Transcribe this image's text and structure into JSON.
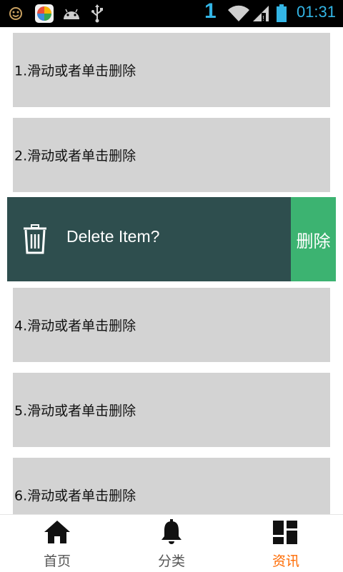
{
  "status_bar": {
    "time": "01:31",
    "signal_digit": "1",
    "icons": [
      "smiley-icon",
      "app-store-icon",
      "android-icon",
      "usb-icon",
      "wifi-icon",
      "signal-icon",
      "battery-icon"
    ]
  },
  "list": {
    "items": [
      {
        "label": "1.滑动或者单击删除"
      },
      {
        "label": "2.滑动或者单击删除"
      },
      {
        "label": "4.滑动或者单击删除"
      },
      {
        "label": "5.滑动或者单击删除"
      },
      {
        "label": "6.滑动或者单击删除"
      }
    ],
    "swiped_item": {
      "prompt": "Delete Item?",
      "delete_label": "删除",
      "icon": "trash-icon"
    }
  },
  "tabbar": {
    "tabs": [
      {
        "label": "首页",
        "icon": "home-icon"
      },
      {
        "label": "分类",
        "icon": "bell-icon"
      },
      {
        "label": "资讯",
        "icon": "dashboard-icon",
        "active": true
      }
    ]
  },
  "colors": {
    "item_bg": "#d3d3d3",
    "swipe_bg": "#2e4e4e",
    "delete_bg": "#3cb371",
    "active_tab": "#ff6a00",
    "status_text": "#33b5e5"
  }
}
